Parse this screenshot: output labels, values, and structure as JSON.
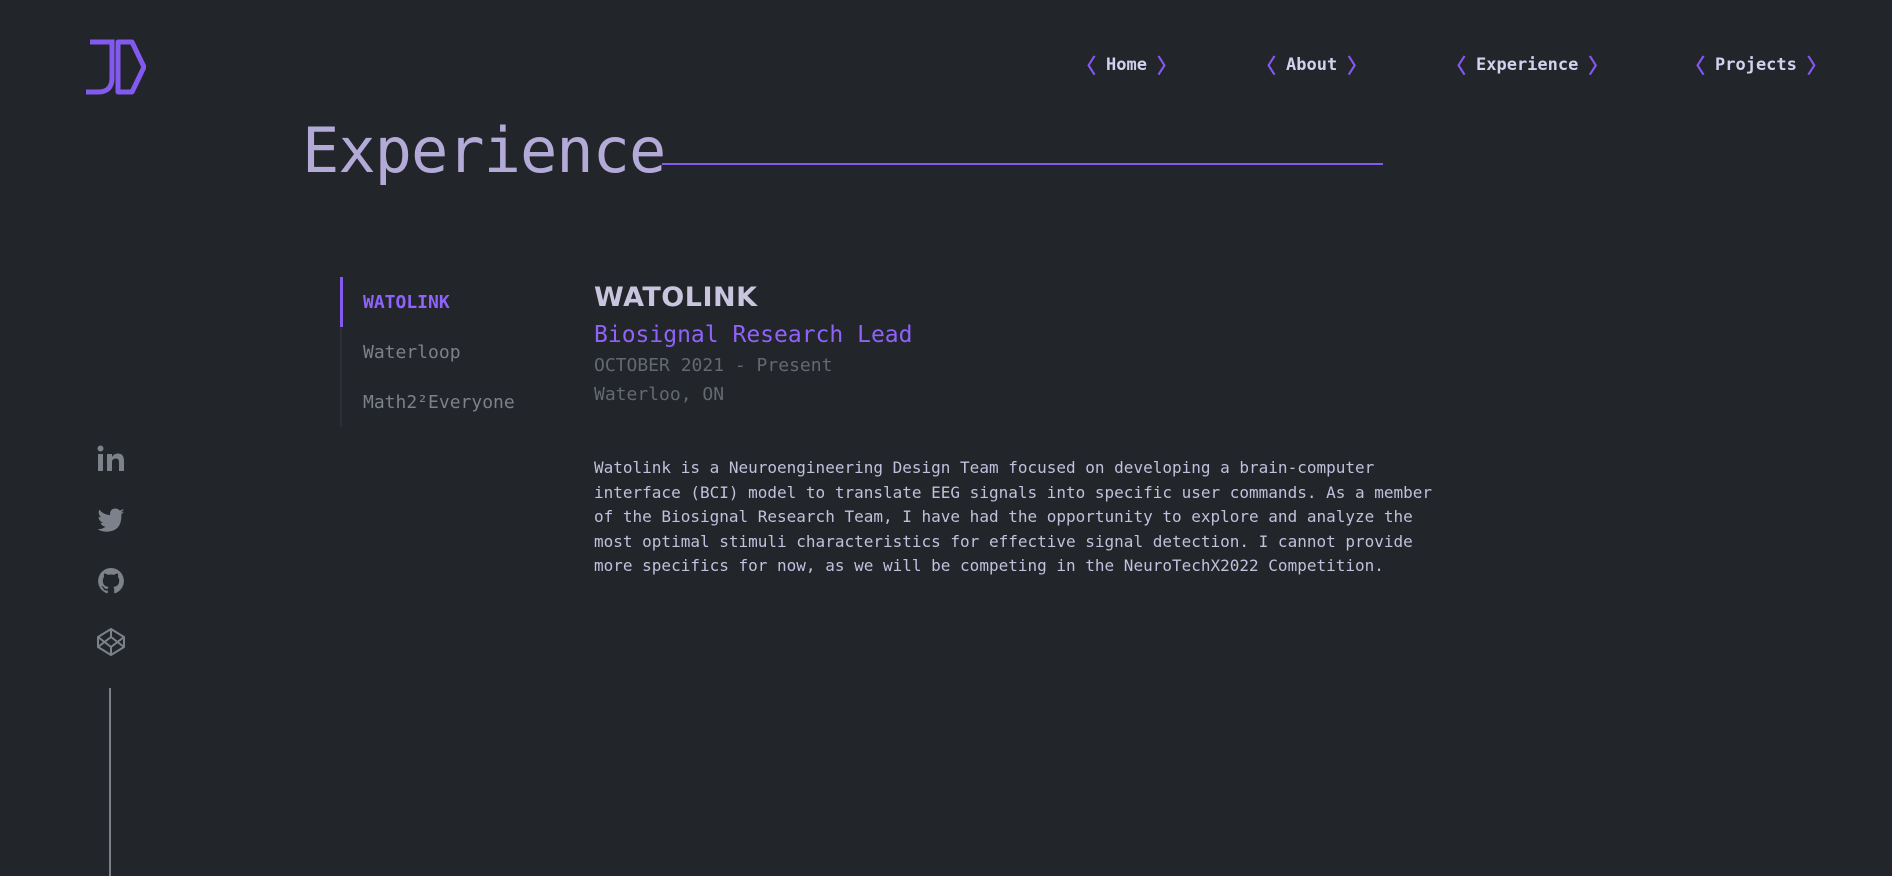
{
  "colors": {
    "background": "#222529",
    "accent": "#8359f0",
    "title": "#b3aad8",
    "muted": "#646971"
  },
  "brand": {
    "logo_icon": "jd-hexagon-logo"
  },
  "nav": {
    "items": [
      {
        "label": "Home"
      },
      {
        "label": "About"
      },
      {
        "label": "Experience"
      },
      {
        "label": "Projects"
      }
    ],
    "bracket_open": "〈",
    "bracket_close": "〉"
  },
  "section": {
    "title": "Experience"
  },
  "tabs": [
    {
      "label": "WATOLINK",
      "active": true
    },
    {
      "label": "Waterloop",
      "active": false
    },
    {
      "label": "Math2²Everyone",
      "active": false
    }
  ],
  "job": {
    "company": "WATOLINK",
    "role": "Biosignal Research Lead",
    "date": "OCTOBER 2021 - Present",
    "location": "Waterloo, ON",
    "description": "Watolink is a Neuroengineering Design Team focused on developing a brain-computer interface (BCI) model to translate EEG signals into specific user commands. As a member of the Biosignal Research Team, I have had the opportunity to explore and analyze the most optimal stimuli characteristics for effective signal detection. I cannot provide more specifics for now, as we will be competing in the NeuroTechX2022 Competition."
  },
  "social": [
    "linkedin-icon",
    "twitter-icon",
    "github-icon",
    "codepen-icon"
  ]
}
